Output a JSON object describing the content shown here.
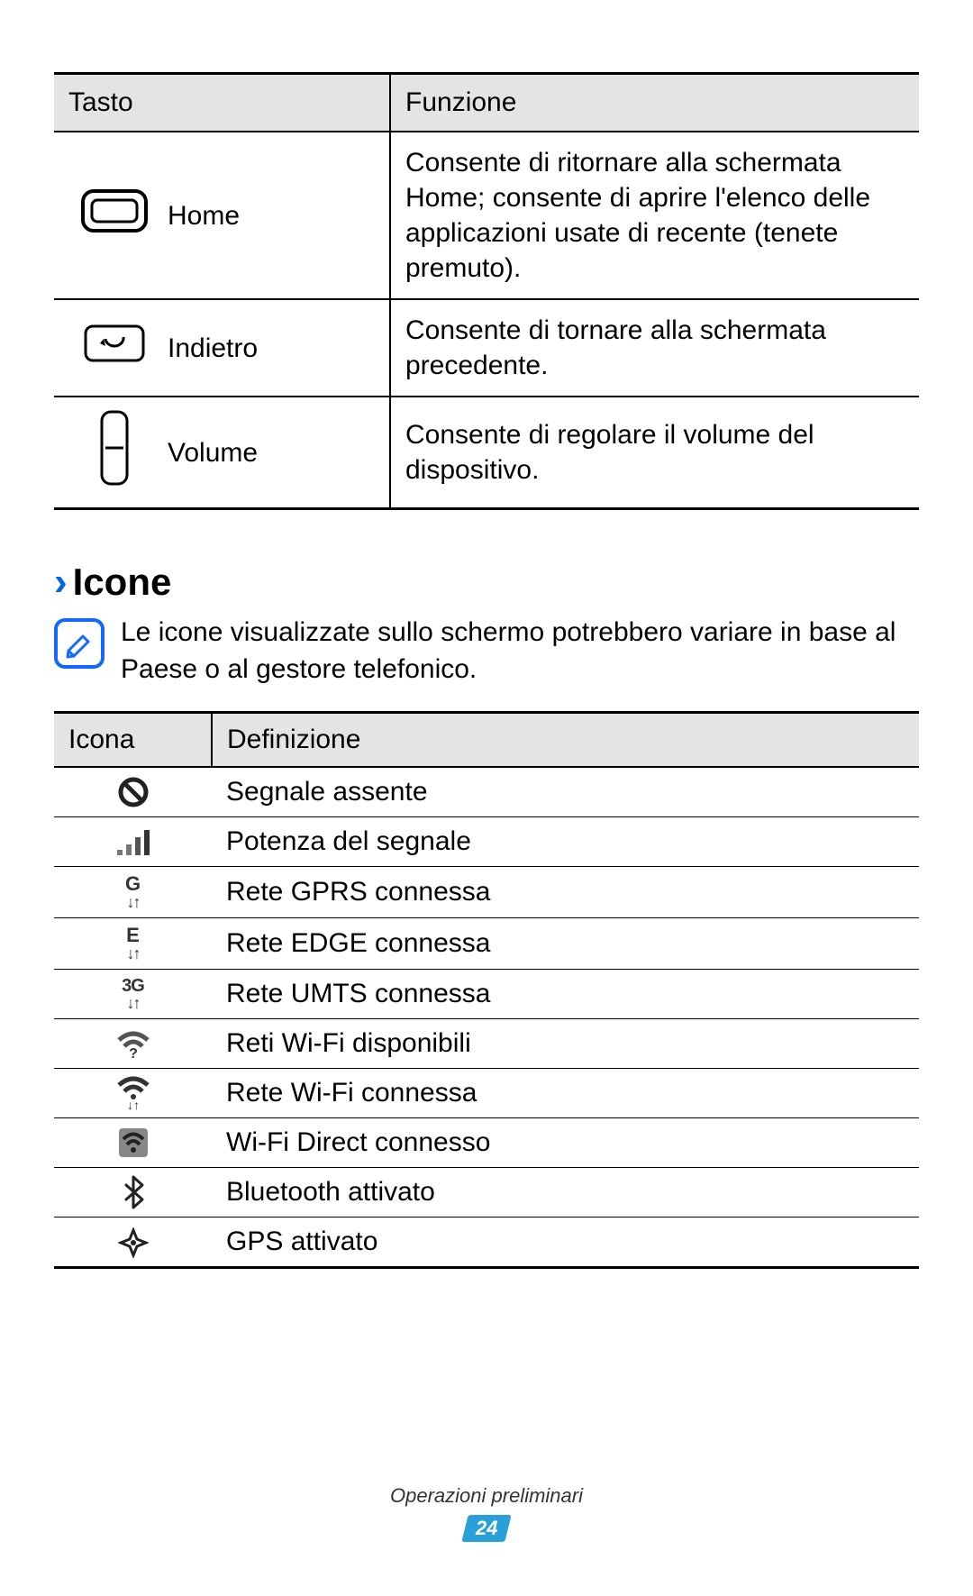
{
  "keys_table": {
    "headers": {
      "key": "Tasto",
      "func": "Funzione"
    },
    "rows": [
      {
        "name": "Home",
        "desc": "Consente di ritornare alla schermata Home; consente di aprire l'elenco delle applicazioni usate di recente (tenete premuto)."
      },
      {
        "name": "Indietro",
        "desc": "Consente di tornare alla schermata precedente."
      },
      {
        "name": "Volume",
        "desc": "Consente di regolare il volume del dispositivo."
      }
    ]
  },
  "section": {
    "title": "Icone",
    "note": "Le icone visualizzate sullo schermo potrebbero variare in base al Paese o al gestore telefonico."
  },
  "icons_table": {
    "headers": {
      "icon": "Icona",
      "def": "Definizione"
    },
    "rows": [
      {
        "def": "Segnale assente"
      },
      {
        "def": "Potenza del segnale"
      },
      {
        "def": "Rete GPRS connessa"
      },
      {
        "def": "Rete EDGE connessa"
      },
      {
        "def": "Rete UMTS connessa"
      },
      {
        "def": "Reti Wi-Fi disponibili"
      },
      {
        "def": "Rete Wi-Fi connessa"
      },
      {
        "def": "Wi-Fi Direct connesso"
      },
      {
        "def": "Bluetooth attivato"
      },
      {
        "def": "GPS attivato"
      }
    ]
  },
  "footer": {
    "section_name": "Operazioni preliminari",
    "page_number": "24"
  }
}
